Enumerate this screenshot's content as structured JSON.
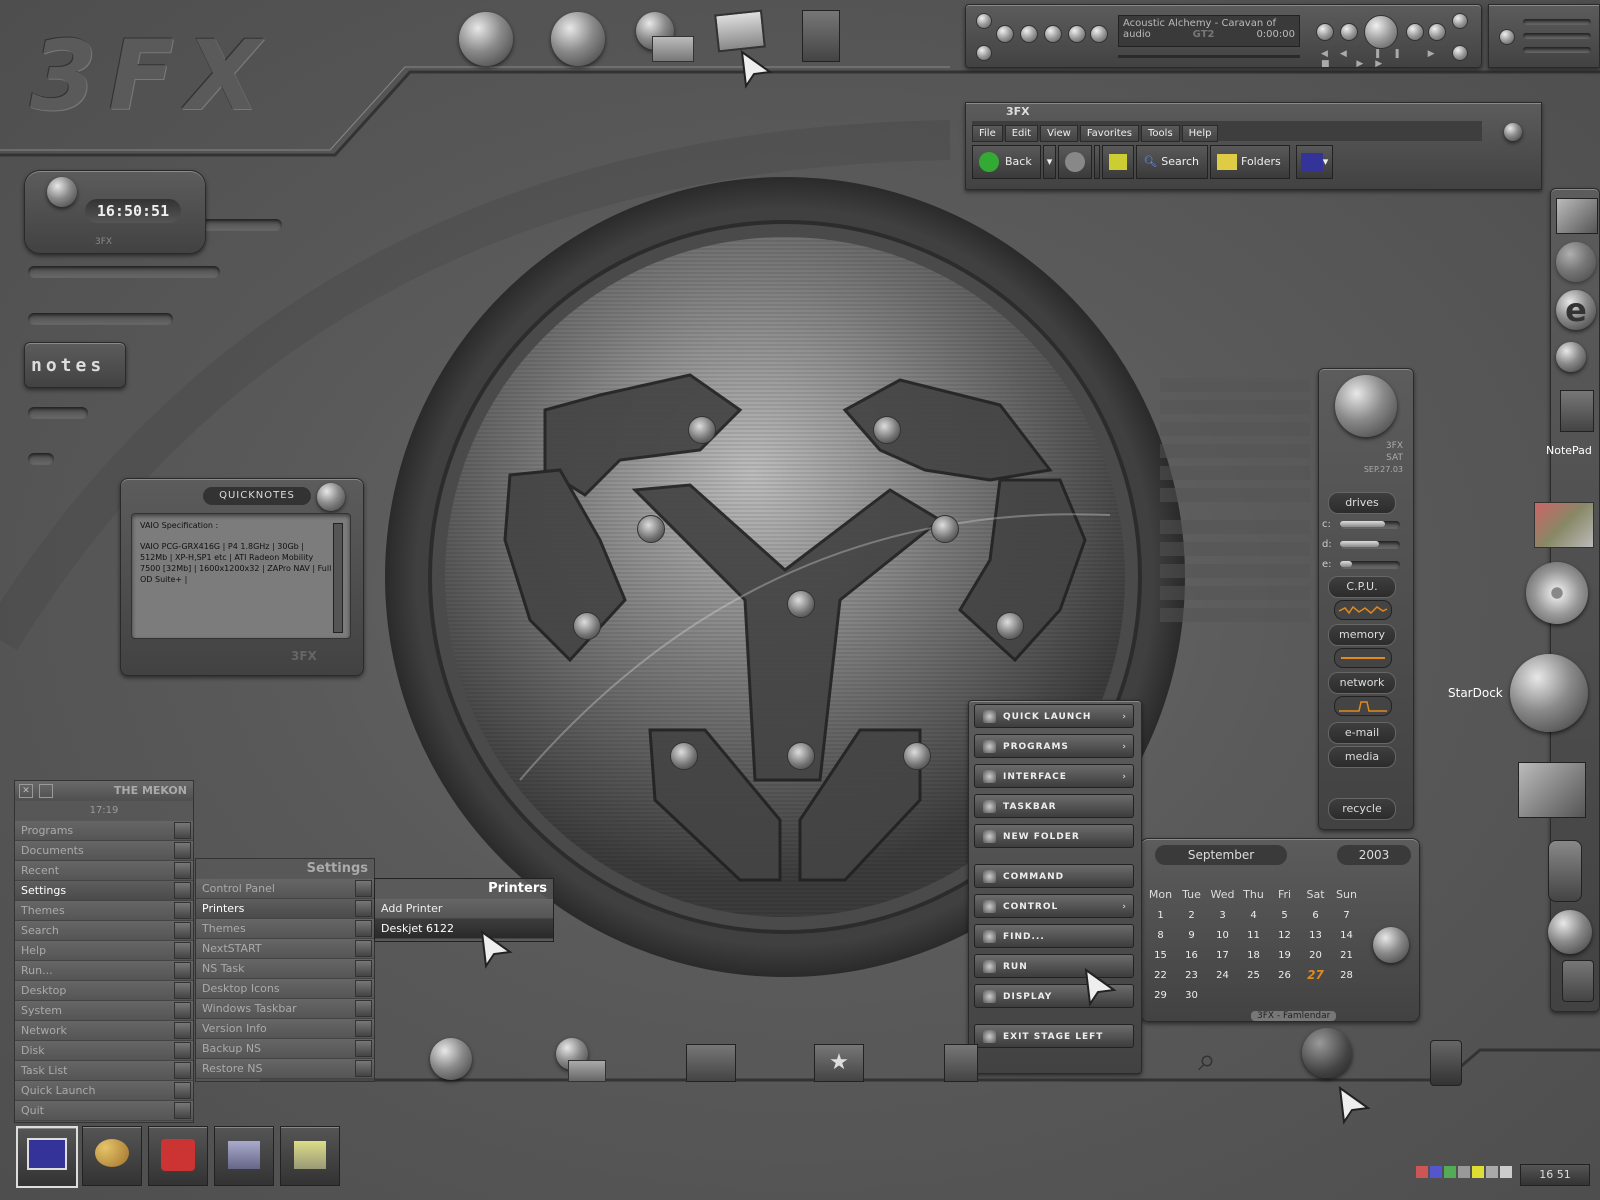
{
  "brand": {
    "logo": "3FX",
    "clock_badge": "3FX",
    "notes_label": "notes"
  },
  "clock": {
    "time": "16:50:51"
  },
  "media_player": {
    "track": "Acoustic Alchemy - Caravan of",
    "track2": "audio",
    "format": "GT2",
    "elapsed": "0:00:00"
  },
  "explorer": {
    "title": "3FX",
    "menus": [
      "File",
      "Edit",
      "View",
      "Favorites",
      "Tools",
      "Help"
    ],
    "back_label": "Back",
    "search_label": "Search",
    "folders_label": "Folders"
  },
  "quicknotes": {
    "title": "QUICKNOTES",
    "heading": "VAIO Specification :",
    "body": "VAIO PCG-GRX416G | P4 1.8GHz | 30Gb | 512Mb | XP-H,SP1 etc | ATI Radeon Mobility 7500 [32Mb] | 1600x1200x32 | ZAPro NAV | Full OD Suite+ |",
    "footer": "3FX"
  },
  "start_menu": {
    "title": "THE MEKON",
    "time": "17:19",
    "items": [
      "Programs",
      "Documents",
      "Recent",
      "Settings",
      "Themes",
      "Search",
      "Help",
      "Run...",
      "Desktop",
      "System",
      "Network",
      "Disk",
      "Task List",
      "Quick Launch",
      "Quit"
    ],
    "active_index": 3
  },
  "settings_menu": {
    "title": "Settings",
    "items": [
      "Control Panel",
      "Printers",
      "Themes",
      "NextSTART",
      "NS Task",
      "Desktop Icons",
      "Windows Taskbar",
      "Version Info",
      "Backup NS",
      "Restore NS"
    ],
    "active_index": 1
  },
  "printers_menu": {
    "title": "Printers",
    "items": [
      "Add Printer",
      "Deskjet 6122"
    ],
    "active_index": 1
  },
  "quick_launch_menu": {
    "items": [
      "QUICK LAUNCH",
      "PROGRAMS",
      "INTERFACE",
      "TASKBAR",
      "NEW FOLDER",
      "COMMAND",
      "CONTROL",
      "FIND...",
      "RUN",
      "DISPLAY",
      "EXIT STAGE LEFT"
    ]
  },
  "system_monitor": {
    "brand": "3FX",
    "day": "SAT",
    "date": "SEP.27.03",
    "drives_label": "drives",
    "drives": [
      {
        "name": "c:",
        "level": 0.75
      },
      {
        "name": "d:",
        "level": 0.65
      },
      {
        "name": "e:",
        "level": 0.2
      }
    ],
    "cpu_label": "C.P.U.",
    "memory_label": "memory",
    "network_label": "network",
    "email_label": "e-mail",
    "media_label": "media",
    "recycle_label": "recycle"
  },
  "calendar": {
    "month": "September",
    "year": "2003",
    "weekdays": [
      "Mon",
      "Tue",
      "Wed",
      "Thu",
      "Fri",
      "Sat",
      "Sun"
    ],
    "weeks": [
      [
        "1",
        "2",
        "3",
        "4",
        "5",
        "6",
        "7"
      ],
      [
        "8",
        "9",
        "10",
        "11",
        "12",
        "13",
        "14"
      ],
      [
        "15",
        "16",
        "17",
        "18",
        "19",
        "20",
        "21"
      ],
      [
        "22",
        "23",
        "24",
        "25",
        "26",
        "27",
        "28"
      ],
      [
        "29",
        "30",
        "",
        "",
        "",
        "",
        ""
      ]
    ],
    "today": "27",
    "footer": "3FX - Famlendar"
  },
  "right_dock": {
    "notepad_label": "NotePad",
    "stardock_label": "StarDock"
  },
  "tray": {
    "time": "16 51"
  },
  "colors": {
    "accent_today": "#e08a1e",
    "background": "#5a5a5a"
  }
}
